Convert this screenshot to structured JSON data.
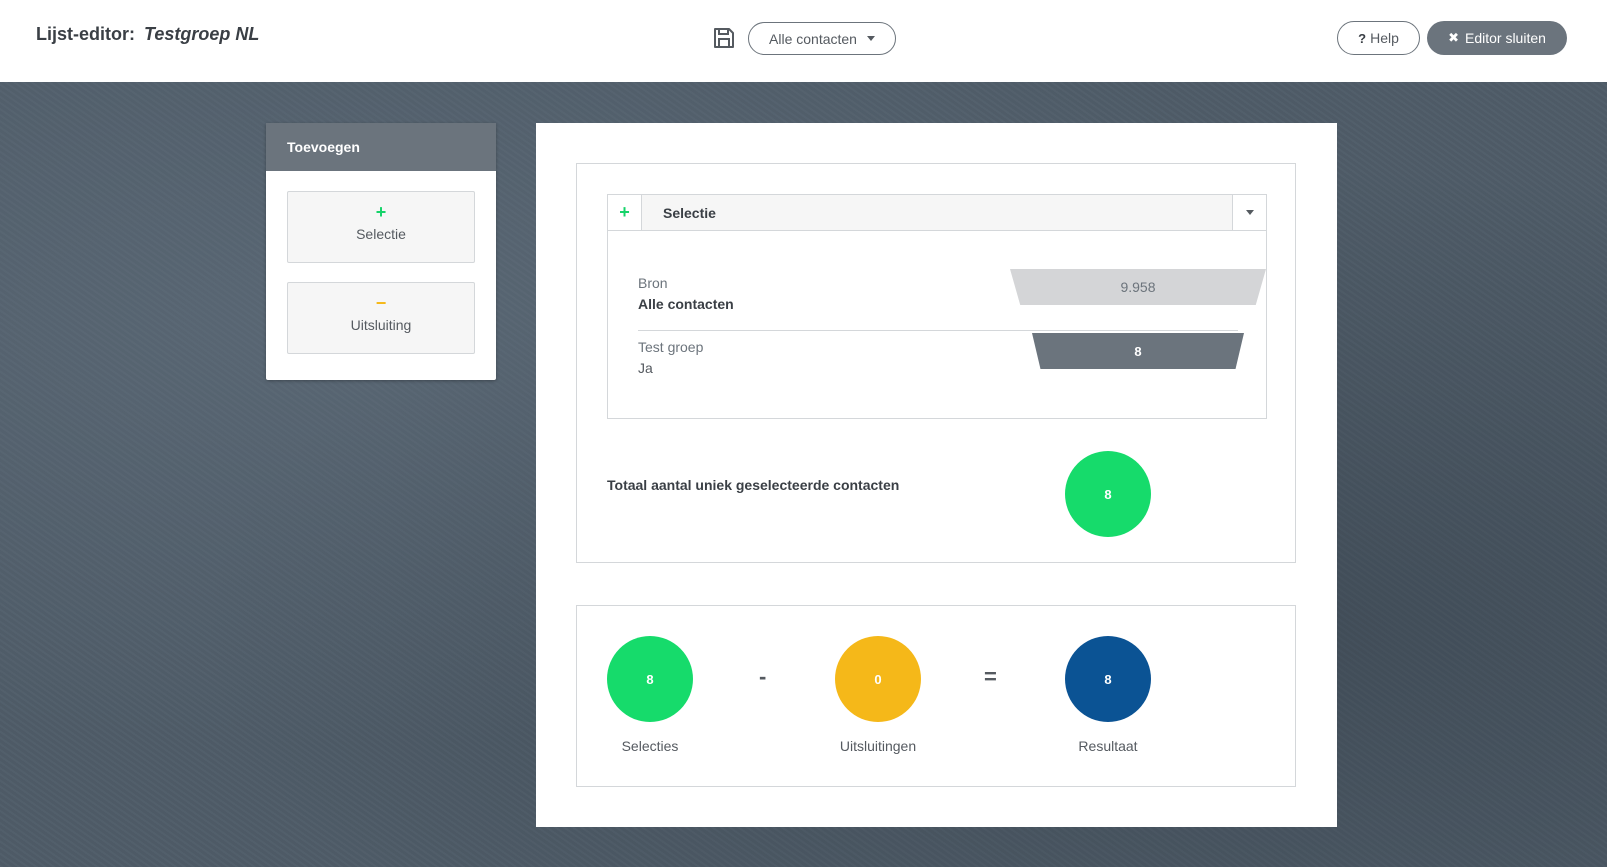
{
  "header": {
    "title_prefix": "Lijst-editor:",
    "title_name": "Testgroep NL",
    "view_dropdown": "Alle contacten",
    "help_label": "Help",
    "close_label": "Editor sluiten"
  },
  "add_panel": {
    "heading": "Toevoegen",
    "items": [
      {
        "icon": "+",
        "label": "Selectie",
        "color": "#16d36a"
      },
      {
        "icon": "−",
        "label": "Uitsluiting",
        "color": "#f5b819"
      }
    ]
  },
  "selection": {
    "header_label": "Selectie",
    "rows": [
      {
        "key": "Bron",
        "value": "Alle contacten",
        "count": "9.958"
      },
      {
        "key": "Test groep",
        "value": "Ja",
        "count": "8"
      }
    ],
    "total_label": "Totaal aantal uniek geselecteerde contacten",
    "total_count": "8"
  },
  "summary": {
    "selections": {
      "count": "8",
      "label": "Selecties"
    },
    "operator_minus": "-",
    "exclusions": {
      "count": "0",
      "label": "Uitsluitingen"
    },
    "operator_equals": "=",
    "result": {
      "count": "8",
      "label": "Resultaat"
    }
  },
  "colors": {
    "selection": "#16db6b",
    "exclusion": "#f5b819",
    "result": "#0b5394",
    "toolbar": "#6b747d"
  }
}
